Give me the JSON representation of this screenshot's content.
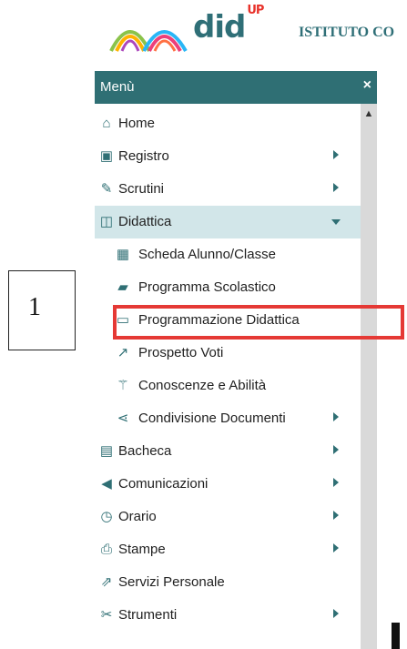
{
  "header": {
    "brand": "did",
    "brand_sup": "UP",
    "school": "ISTITUTO CO"
  },
  "page_number": "1",
  "menu": {
    "title": "Menù",
    "close_icon": "×",
    "items": [
      {
        "label": "Home",
        "icon": "home-icon",
        "glyph": "⌂",
        "level": 0,
        "arrow": "none"
      },
      {
        "label": "Registro",
        "icon": "calendar-check-icon",
        "glyph": "▣",
        "level": 0,
        "arrow": "right"
      },
      {
        "label": "Scrutini",
        "icon": "file-edit-icon",
        "glyph": "✎",
        "level": 0,
        "arrow": "right"
      },
      {
        "label": "Didattica",
        "icon": "book-open-icon",
        "glyph": "◫",
        "level": 0,
        "arrow": "down",
        "active": true
      },
      {
        "label": "Scheda Alunno/Classe",
        "icon": "table-icon",
        "glyph": "▦",
        "level": 1,
        "arrow": "none"
      },
      {
        "label": "Programma Scolastico",
        "icon": "book-icon",
        "glyph": "▰",
        "level": 1,
        "arrow": "none"
      },
      {
        "label": "Programmazione Didattica",
        "icon": "keyboard-icon",
        "glyph": "▭",
        "level": 1,
        "arrow": "none"
      },
      {
        "label": "Prospetto Voti",
        "icon": "line-chart-icon",
        "glyph": "↗",
        "level": 1,
        "arrow": "none"
      },
      {
        "label": "Conoscenze e Abilità",
        "icon": "magic-wand-icon",
        "glyph": "⚚",
        "level": 1,
        "arrow": "none"
      },
      {
        "label": "Condivisione Documenti",
        "icon": "share-icon",
        "glyph": "⋖",
        "level": 1,
        "arrow": "right"
      },
      {
        "label": "Bacheca",
        "icon": "newspaper-icon",
        "glyph": "▤",
        "level": 0,
        "arrow": "right"
      },
      {
        "label": "Comunicazioni",
        "icon": "megaphone-icon",
        "glyph": "◀",
        "level": 0,
        "arrow": "right"
      },
      {
        "label": "Orario",
        "icon": "clock-icon",
        "glyph": "◷",
        "level": 0,
        "arrow": "right"
      },
      {
        "label": "Stampe",
        "icon": "printer-icon",
        "glyph": "⎙",
        "level": 0,
        "arrow": "right"
      },
      {
        "label": "Servizi Personale",
        "icon": "external-link-icon",
        "glyph": "⇗",
        "level": 0,
        "arrow": "none"
      },
      {
        "label": "Strumenti",
        "icon": "tools-icon",
        "glyph": "✂",
        "level": 0,
        "arrow": "right"
      }
    ]
  },
  "colors": {
    "header_bg": "#2f6f74",
    "active_bg": "#d2e6e9",
    "highlight": "#e53935"
  }
}
